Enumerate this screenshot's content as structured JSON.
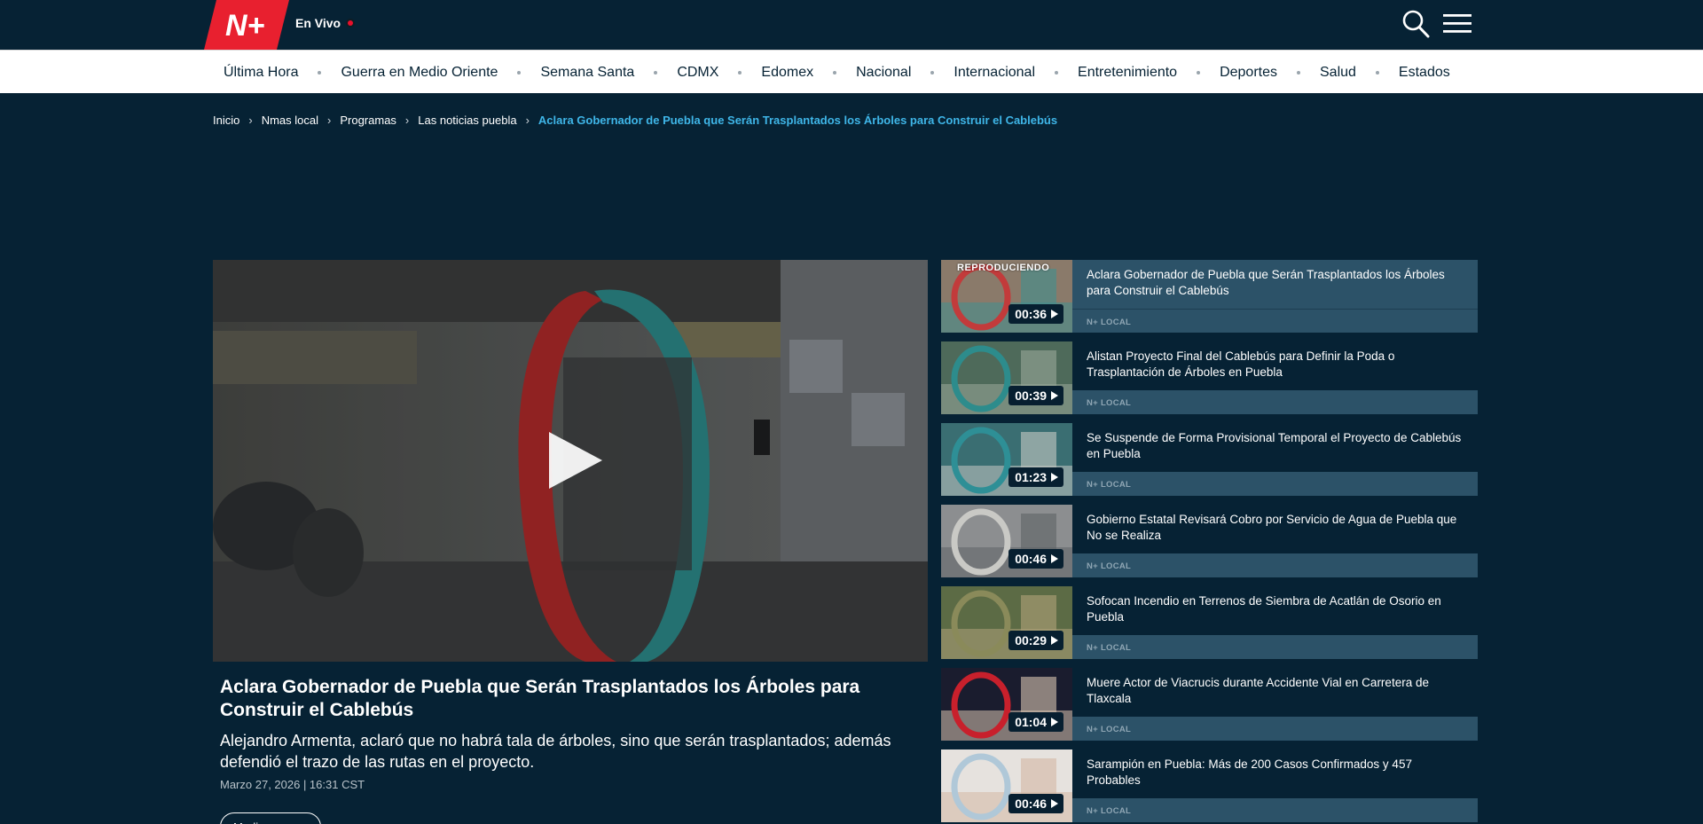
{
  "header": {
    "logo_text": "N+",
    "live_label": "En Vivo",
    "colors": {
      "brand_red": "#e8202f",
      "bg": "#062234",
      "accent": "#3fb6e8"
    },
    "icons": [
      "search-icon",
      "hamburger-menu-icon"
    ]
  },
  "nav": {
    "items": [
      "Última Hora",
      "Guerra en Medio Oriente",
      "Semana Santa",
      "CDMX",
      "Edomex",
      "Nacional",
      "Internacional",
      "Entretenimiento",
      "Deportes",
      "Salud",
      "Estados"
    ]
  },
  "breadcrumb": {
    "items": [
      "Inicio",
      "Nmas local",
      "Programas",
      "Las noticias puebla"
    ],
    "current": "Aclara Gobernador de Puebla que Serán Trasplantados los Árboles para Construir el Cablebús"
  },
  "main_video": {
    "title": "Aclara Gobernador de Puebla que Serán Trasplantados los Árboles para Construir el Cablebús",
    "description": "Alejandro Armenta, aclaró que no habrá tala de árboles, sino que serán trasplantados; además defendió el trazo de las rutas en el proyecto.",
    "date": "Marzo 27, 2026 | 16:31 CST",
    "more_label": "Media Ambiente"
  },
  "playlist": {
    "playing_label": "REPRODUCIENDO",
    "items": [
      {
        "title": "Aclara Gobernador de Puebla que Serán Trasplantados los Árboles para Construir el Cablebús",
        "duration": "00:36",
        "tag": "N+ LOCAL",
        "active": true
      },
      {
        "title": "Alistan Proyecto Final del Cablebús para Definir la Poda o Trasplantación de Árboles en Puebla",
        "duration": "00:39",
        "tag": "N+ LOCAL",
        "active": false
      },
      {
        "title": "Se Suspende de Forma Provisional Temporal el Proyecto de Cablebús en Puebla",
        "duration": "01:23",
        "tag": "N+ LOCAL",
        "active": false
      },
      {
        "title": "Gobierno Estatal Revisará Cobro por Servicio de Agua de Puebla que No se Realiza",
        "duration": "00:46",
        "tag": "N+ LOCAL",
        "active": false
      },
      {
        "title": "Sofocan Incendio en Terrenos de Siembra de Acatlán de Osorio en Puebla",
        "duration": "00:29",
        "tag": "N+ LOCAL",
        "active": false
      },
      {
        "title": "Muere Actor de Viacrucis durante Accidente Vial en Carretera de Tlaxcala",
        "duration": "01:04",
        "tag": "N+ LOCAL",
        "active": false
      },
      {
        "title": "Sarampión en Puebla: Más de 200 Casos Confirmados y 457 Probables",
        "duration": "00:46",
        "tag": "N+ LOCAL",
        "active": false
      }
    ]
  }
}
